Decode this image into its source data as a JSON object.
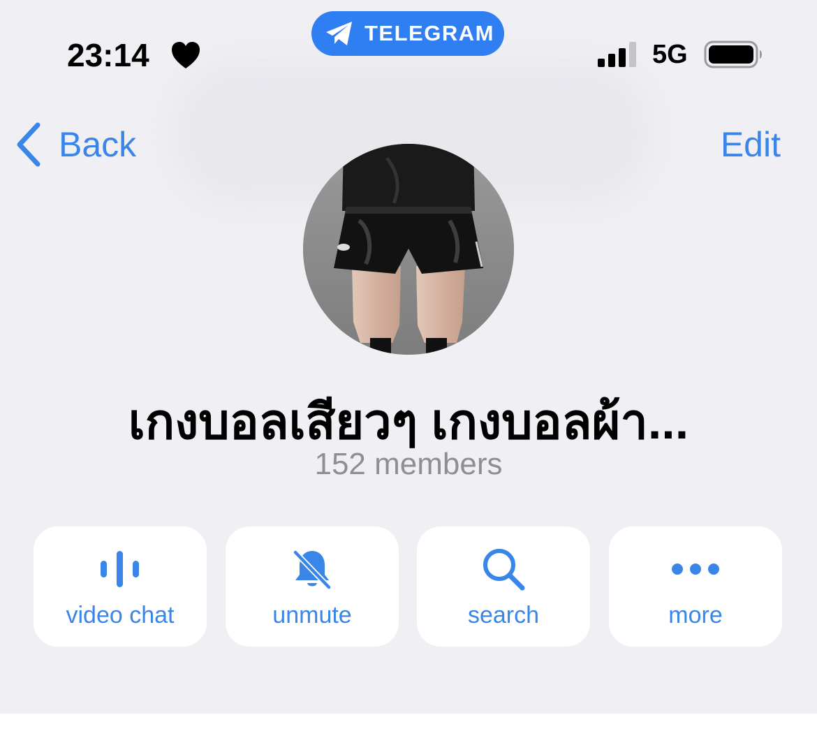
{
  "status_bar": {
    "time": "23:14",
    "app_pill_label": "TELEGRAM",
    "network": "5G",
    "signal_bars_filled": 3,
    "signal_bars_total": 4
  },
  "nav": {
    "back_label": "Back",
    "edit_label": "Edit"
  },
  "profile": {
    "title": "เกงบอลเสียวๆ เกงบอลผ้า...",
    "members": "152 members"
  },
  "actions": [
    {
      "label": "video chat",
      "icon": "voice-chat-icon"
    },
    {
      "label": "unmute",
      "icon": "bell-slash-icon"
    },
    {
      "label": "search",
      "icon": "search-icon"
    },
    {
      "label": "more",
      "icon": "more-dots-icon"
    }
  ],
  "colors": {
    "accent": "#3a86e8",
    "pill": "#2f7ef2",
    "background": "#efeff4",
    "secondary_text": "#8e8e93"
  }
}
